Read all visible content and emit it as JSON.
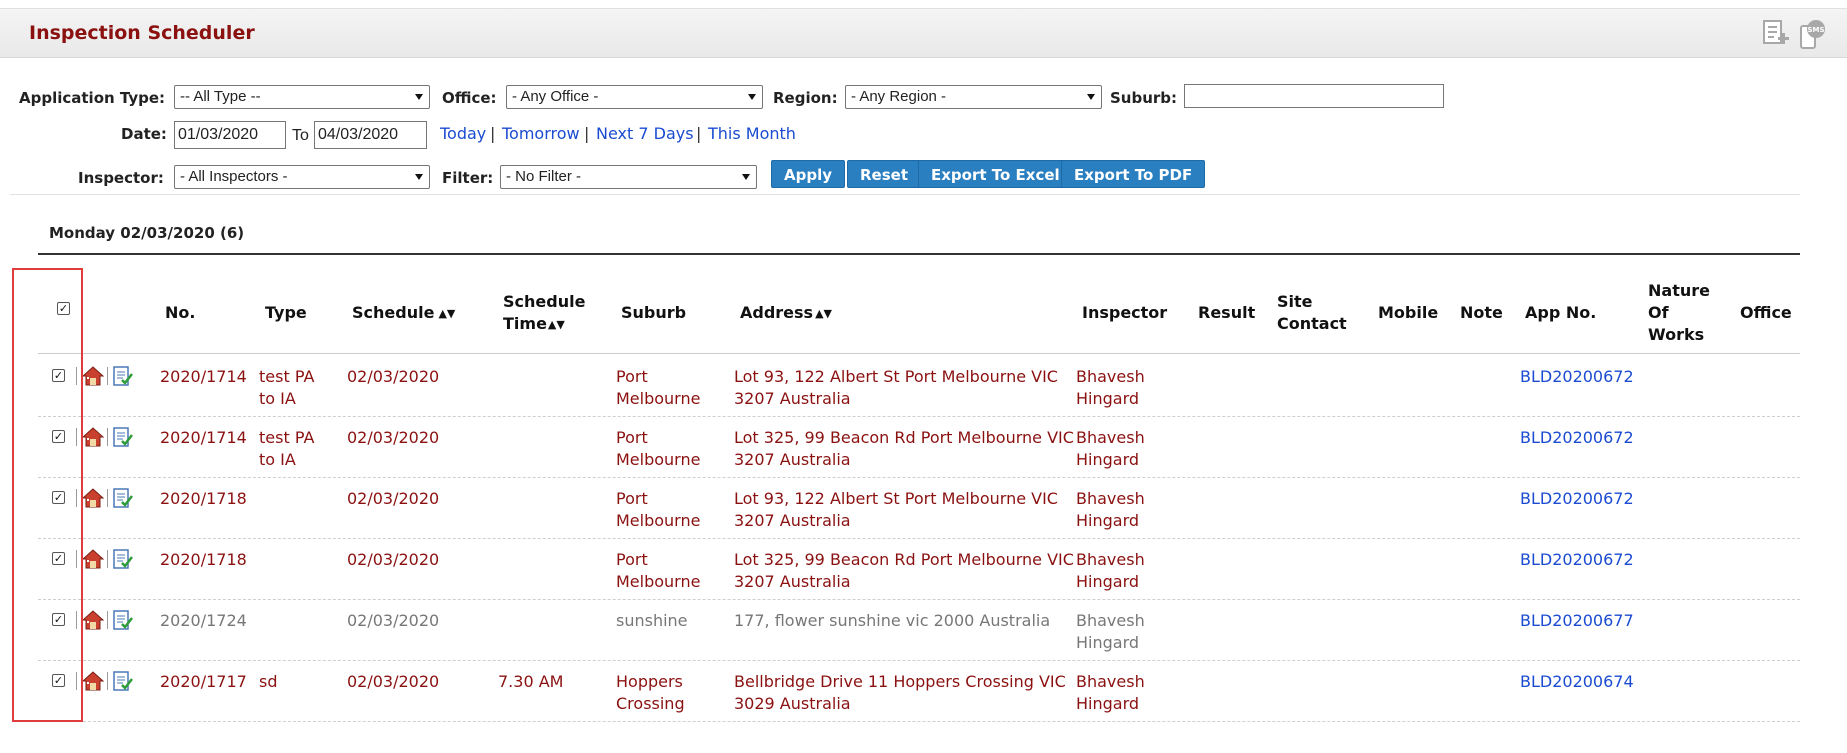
{
  "header": {
    "title": "Inspection Scheduler",
    "icons": [
      "add-document-icon",
      "sms-icon"
    ]
  },
  "filters": {
    "application_type_label": "Application Type:",
    "application_type_value": "-- All Type --",
    "office_label": "Office:",
    "office_value": "- Any Office -",
    "region_label": "Region:",
    "region_value": "- Any Region -",
    "suburb_label": "Suburb:",
    "suburb_value": "",
    "date_label": "Date:",
    "date_from": "01/03/2020",
    "to_label": "To",
    "date_to": "04/03/2020",
    "quick_links": [
      "Today",
      "Tomorrow",
      "Next 7 Days",
      "This Month"
    ],
    "inspector_label": "Inspector:",
    "inspector_value": "- All Inspectors -",
    "filter_label": "Filter:",
    "filter_value": "- No Filter -"
  },
  "buttons": {
    "apply": "Apply",
    "reset": "Reset",
    "export_excel": "Export To Excel",
    "export_pdf": "Export To PDF"
  },
  "day": {
    "title": "Monday 02/03/2020 (6)"
  },
  "table": {
    "columns": {
      "no": "No.",
      "type": "Type",
      "schedule": "Schedule",
      "schedule_time_1": "Schedule",
      "schedule_time_2": "Time",
      "suburb": "Suburb",
      "address": "Address",
      "inspector": "Inspector",
      "result": "Result",
      "site_contact_1": "Site",
      "site_contact_2": "Contact",
      "mobile": "Mobile",
      "note": "Note",
      "app_no": "App No.",
      "nature_1": "Nature",
      "nature_2": "Of",
      "nature_3": "Works",
      "office": "Office"
    },
    "rows": [
      {
        "checked": true,
        "no": "2020/1714",
        "type_1": "test PA",
        "type_2": "to IA",
        "schedule": "02/03/2020",
        "time": "",
        "suburb_1": "Port",
        "suburb_2": "Melbourne",
        "address_1": "Lot 93, 122 Albert St Port Melbourne VIC",
        "address_2": "3207 Australia",
        "inspector_1": "Bhavesh",
        "inspector_2": "Hingard",
        "app_no": "BLD20200672",
        "style": "red"
      },
      {
        "checked": true,
        "no": "2020/1714",
        "type_1": "test PA",
        "type_2": "to IA",
        "schedule": "02/03/2020",
        "time": "",
        "suburb_1": "Port",
        "suburb_2": "Melbourne",
        "address_1": "Lot 325, 99 Beacon Rd Port Melbourne VIC",
        "address_2": "3207 Australia",
        "inspector_1": "Bhavesh",
        "inspector_2": "Hingard",
        "app_no": "BLD20200672",
        "style": "red"
      },
      {
        "checked": true,
        "no": "2020/1718",
        "type_1": "",
        "type_2": "",
        "schedule": "02/03/2020",
        "time": "",
        "suburb_1": "Port",
        "suburb_2": "Melbourne",
        "address_1": "Lot 93, 122 Albert St Port Melbourne VIC",
        "address_2": "3207 Australia",
        "inspector_1": "Bhavesh",
        "inspector_2": "Hingard",
        "app_no": "BLD20200672",
        "style": "red"
      },
      {
        "checked": true,
        "no": "2020/1718",
        "type_1": "",
        "type_2": "",
        "schedule": "02/03/2020",
        "time": "",
        "suburb_1": "Port",
        "suburb_2": "Melbourne",
        "address_1": "Lot 325, 99 Beacon Rd Port Melbourne VIC",
        "address_2": "3207 Australia",
        "inspector_1": "Bhavesh",
        "inspector_2": "Hingard",
        "app_no": "BLD20200672",
        "style": "red"
      },
      {
        "checked": true,
        "no": "2020/1724",
        "type_1": "",
        "type_2": "",
        "schedule": "02/03/2020",
        "time": "",
        "suburb_1": "sunshine",
        "suburb_2": "",
        "address_1": "177, flower sunshine vic 2000 Australia",
        "address_2": "",
        "inspector_1": "Bhavesh",
        "inspector_2": "Hingard",
        "app_no": "BLD20200677",
        "style": "gray"
      },
      {
        "checked": true,
        "no": "2020/1717",
        "type_1": "sd",
        "type_2": "",
        "schedule": "02/03/2020",
        "time": "7.30 AM",
        "suburb_1": "Hoppers",
        "suburb_2": "Crossing",
        "address_1": "Bellbridge Drive 11 Hoppers Crossing VIC",
        "address_2": "3029 Australia",
        "inspector_1": "Bhavesh",
        "inspector_2": "Hingard",
        "app_no": "BLD20200674",
        "style": "red"
      }
    ]
  },
  "colors": {
    "title": "#8b1111",
    "row_text": "#8b1111",
    "muted_text": "#777777",
    "link": "#1a4bd1",
    "button": "#2a7fc0",
    "highlight_box": "#e03c3c"
  }
}
